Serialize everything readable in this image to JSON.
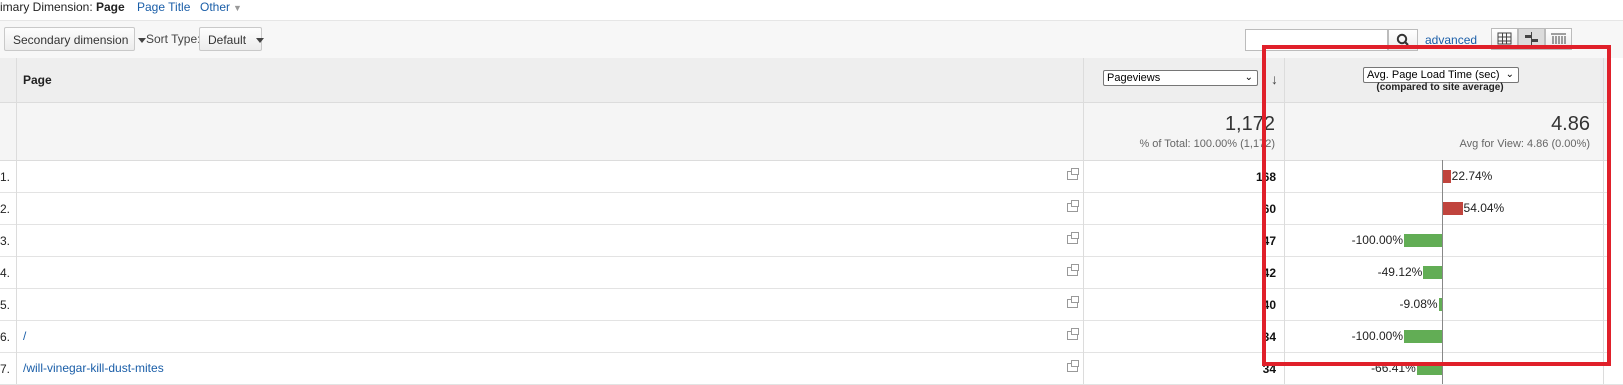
{
  "dimension_bar": {
    "label": "rimary Dimension:",
    "current": "Page",
    "links": [
      "Page Title",
      "Other"
    ]
  },
  "toolbar": {
    "secondary_dimension": "Secondary dimension",
    "sort_type_label": "Sort Type:",
    "sort_type_value": "Default",
    "search_value": "",
    "advanced": "advanced"
  },
  "table": {
    "page_header": "Page",
    "metric1_select": "Pageviews",
    "metric2_select": "Avg. Page Load Time (sec)",
    "metric2_sub": "(compared to site average)",
    "summary": {
      "pageviews": "1,172",
      "pageviews_sub": "% of Total: 100.00% (1,172)",
      "loadtime": "4.86",
      "loadtime_sub": "Avg for View: 4.86 (0.00%)"
    },
    "rows": [
      {
        "num": "1.",
        "page": "",
        "pageviews": "168",
        "delta_label": "22.74%",
        "delta": 22.74
      },
      {
        "num": "2.",
        "page": "",
        "pageviews": "60",
        "delta_label": "54.04%",
        "delta": 54.04
      },
      {
        "num": "3.",
        "page": "",
        "pageviews": "47",
        "delta_label": "-100.00%",
        "delta": -100.0
      },
      {
        "num": "4.",
        "page": "",
        "pageviews": "42",
        "delta_label": "-49.12%",
        "delta": -49.12
      },
      {
        "num": "5.",
        "page": "",
        "pageviews": "40",
        "delta_label": "-9.08%",
        "delta": -9.08
      },
      {
        "num": "6.",
        "page": "/",
        "pageviews": "34",
        "delta_label": "-100.00%",
        "delta": -100.0
      },
      {
        "num": "7.",
        "page": "/will-vinegar-kill-dust-mites",
        "pageviews": "34",
        "delta_label": "-66.41%",
        "delta": -66.41
      }
    ]
  },
  "colors": {
    "positive_bar": "#c0443d",
    "negative_bar": "#62ad55",
    "highlight": "#e0202a",
    "link": "#1a5ea8"
  }
}
